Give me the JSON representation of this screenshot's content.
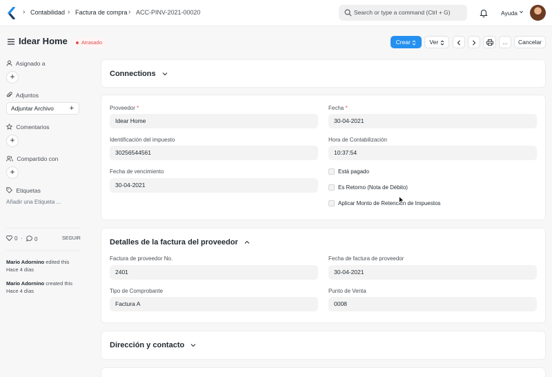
{
  "breadcrumbs": [
    "Contabilidad",
    "Factura de compra",
    "ACC-PINV-2021-00020"
  ],
  "search": {
    "placeholder": "Search or type a command (Ctrl + G)"
  },
  "navbar": {
    "help_label": "Ayuda"
  },
  "page": {
    "title": "Idear Home",
    "status": "Atrasado"
  },
  "actions": {
    "create": "Crear",
    "view": "Ver",
    "more": "...",
    "cancel": "Cancelar"
  },
  "sidebar": {
    "assigned": "Asignado a",
    "attachments": "Adjuntos",
    "attach_button": "Adjuntar Archivo",
    "comments": "Comentarios",
    "shared": "Compartido con",
    "tags": "Etiquetas",
    "add_tag": "Añadir una Etiqueta ...",
    "likes": "0",
    "comment_count": "0",
    "follow": "SEGUIR",
    "activity": [
      {
        "user": "Mario Adornino",
        "action": "edited this",
        "time": "Hace 4 días"
      },
      {
        "user": "Mario Adornino",
        "action": "created this",
        "time": "Hace 4 días"
      }
    ]
  },
  "sections": {
    "connections": "Connections",
    "supplier_details": "Detalles de la factura del proveedor",
    "address": "Dirección y contacto"
  },
  "form": {
    "supplier": {
      "label": "Proveedor",
      "value": "Idear Home"
    },
    "date": {
      "label": "Fecha",
      "value": "30-04-2021"
    },
    "tax_id": {
      "label": "Identificación del impuesto",
      "value": "30256544561"
    },
    "posting_time": {
      "label": "Hora de Contabilización",
      "value": "10:37:54"
    },
    "due_date": {
      "label": "Fecha de vencimiento",
      "value": "30-04-2021"
    },
    "is_paid": "Está pagado",
    "is_return": "Es Retorno (Nota de Débito)",
    "apply_tds": "Aplicar Monto de Retención de Impuestos",
    "bill_no": {
      "label": "Factura de proveedor No.",
      "value": "2401"
    },
    "bill_date": {
      "label": "Fecha de factura de proveedor",
      "value": "30-04-2021"
    },
    "voucher_type": {
      "label": "Tipo de Comprobante",
      "value": "Factura A"
    },
    "point_of_sale": {
      "label": "Punto de Venta",
      "value": "0008"
    }
  },
  "colors": {
    "primary": "#2490ef",
    "overdue": "#e24c4c"
  }
}
